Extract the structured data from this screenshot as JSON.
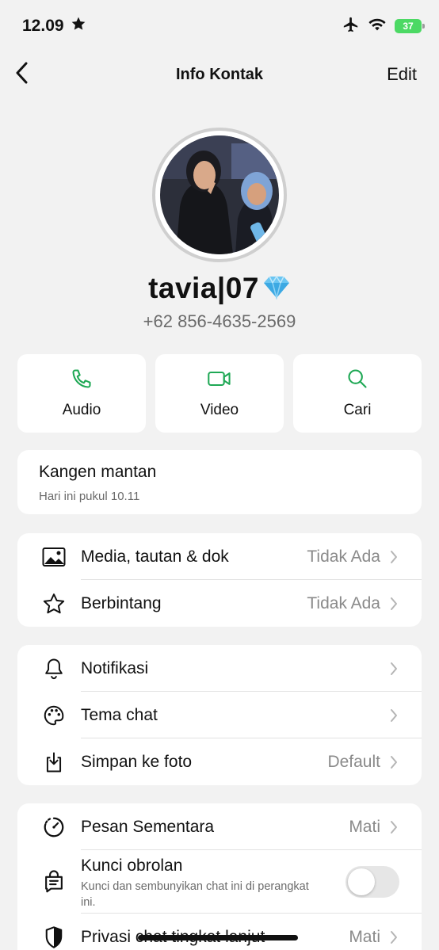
{
  "status_bar": {
    "time": "12.09",
    "battery": "37"
  },
  "nav": {
    "title": "Info Kontak",
    "edit_label": "Edit"
  },
  "profile": {
    "name": "tavia|07",
    "name_emoji": "💎",
    "phone": "+62 856-4635-2569"
  },
  "actions": [
    {
      "label": "Audio",
      "icon": "phone-icon"
    },
    {
      "label": "Video",
      "icon": "video-icon"
    },
    {
      "label": "Cari",
      "icon": "search-icon"
    }
  ],
  "about": {
    "text": "Kangen mantan",
    "time": "Hari ini pukul 10.11"
  },
  "media_section": [
    {
      "label": "Media, tautan & dok",
      "value": "Tidak Ada",
      "icon": "image-icon"
    },
    {
      "label": "Berbintang",
      "value": "Tidak Ada",
      "icon": "star-icon"
    }
  ],
  "settings_section": [
    {
      "label": "Notifikasi",
      "value": "",
      "icon": "bell-icon"
    },
    {
      "label": "Tema chat",
      "value": "",
      "icon": "palette-icon"
    },
    {
      "label": "Simpan ke foto",
      "value": "Default",
      "icon": "download-icon"
    }
  ],
  "privacy_section": {
    "disappearing": {
      "label": "Pesan Sementara",
      "value": "Mati",
      "icon": "timer-icon"
    },
    "chat_lock": {
      "label": "Kunci obrolan",
      "description": "Kunci dan sembunyikan chat ini di perangkat ini.",
      "enabled": false,
      "icon": "lock-chat-icon"
    },
    "advanced_privacy": {
      "label": "Privasi chat tingkat lanjut",
      "value": "Mati",
      "icon": "shield-icon"
    }
  },
  "colors": {
    "accent": "#1fa855",
    "background": "#f2f2f2",
    "card": "#ffffff"
  }
}
